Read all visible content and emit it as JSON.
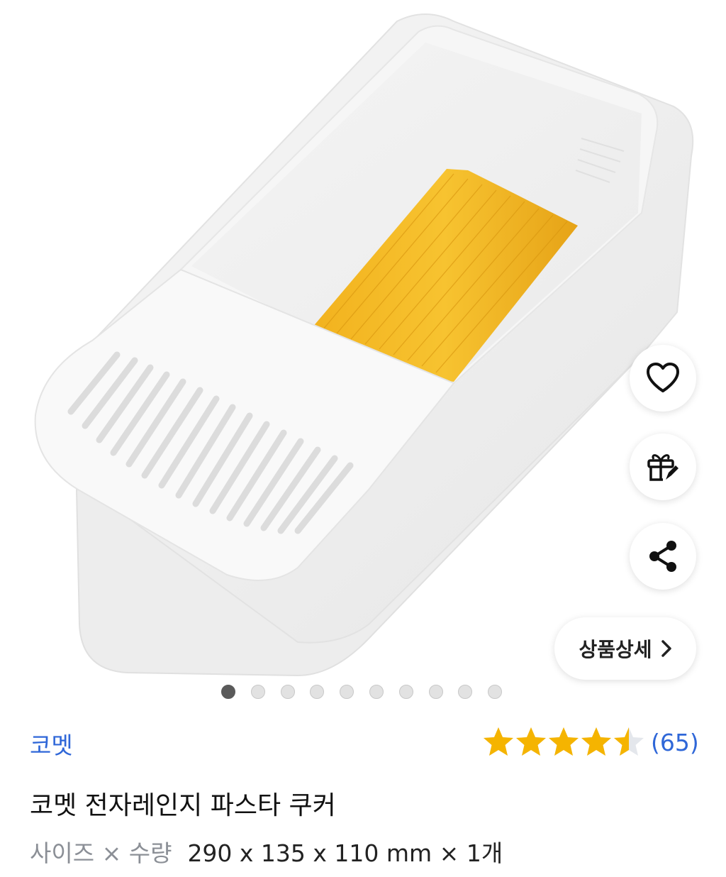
{
  "product": {
    "image_count": 10,
    "active_image": 1,
    "brand": "코멧",
    "title": "코멧 전자레인지 파스타 쿠커",
    "rating": 4.5,
    "rating_max": 5,
    "review_count": "(65)",
    "spec_label": "사이즈 × 수량",
    "spec_value": "290 x 135 x 110 mm × 1개"
  },
  "actions": {
    "favorite_icon": "heart-icon",
    "gift_icon": "gift-icon",
    "share_icon": "share-icon",
    "detail_label": "상품상세",
    "detail_icon": "chevron-right-icon"
  },
  "colors": {
    "accent": "#2f67d8",
    "star": "#f5b400",
    "star_empty": "#e4e7ec",
    "dot_active": "#5a5a5a",
    "dot_inactive": "#e2e2e2"
  }
}
